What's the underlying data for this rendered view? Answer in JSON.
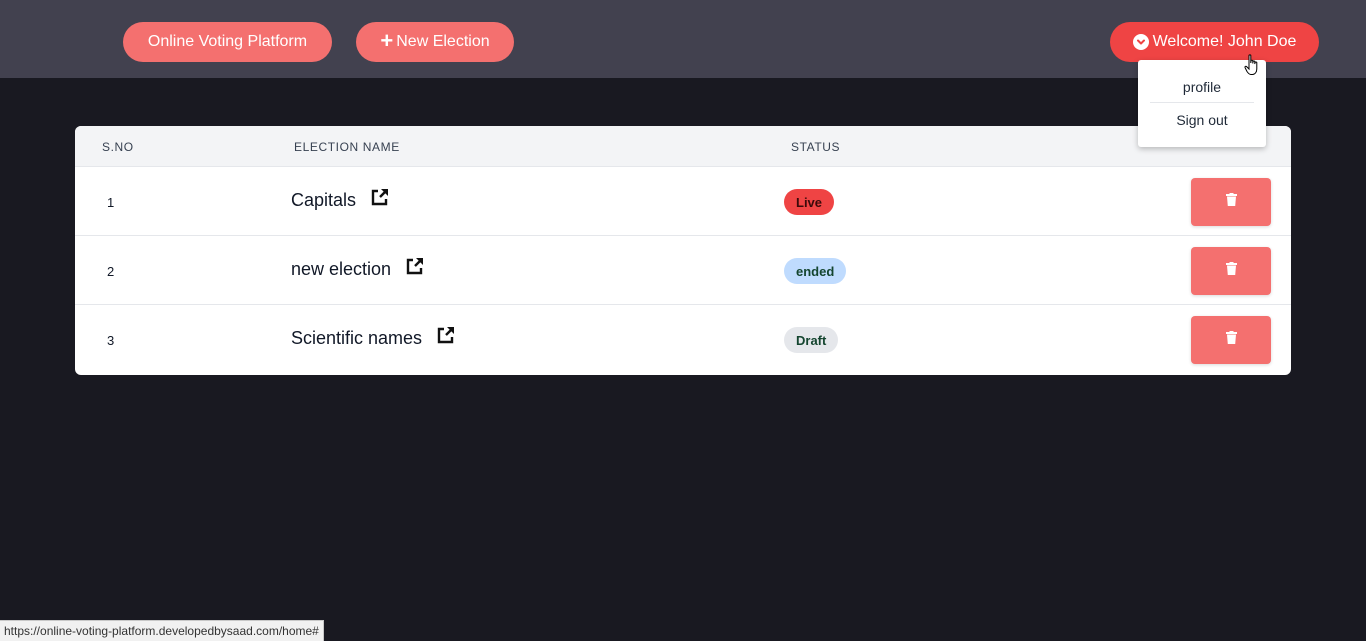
{
  "header": {
    "brand_label": "Online Voting Platform",
    "new_election_label": "New Election",
    "welcome_label": "Welcome! John Doe"
  },
  "user_menu": {
    "profile_label": "profile",
    "signout_label": "Sign out"
  },
  "table": {
    "columns": {
      "sno": "S.NO",
      "name": "ELECTION NAME",
      "status": "STATUS"
    },
    "rows": [
      {
        "sno": "1",
        "name": "Capitals",
        "status": "Live"
      },
      {
        "sno": "2",
        "name": "new election",
        "status": "ended"
      },
      {
        "sno": "3",
        "name": "Scientific names",
        "status": "Draft"
      }
    ]
  },
  "status_colors": {
    "Live": {
      "bg": "#ef4444",
      "fg": "#3b0a0a"
    },
    "ended": {
      "bg": "#bfdbfe",
      "fg": "#14452f"
    },
    "Draft": {
      "bg": "#e5e7eb",
      "fg": "#14452f"
    }
  },
  "colors": {
    "accent": "#f4706f",
    "welcome": "#ef4444"
  },
  "status_bar": {
    "url": "https://online-voting-platform.developedbysaad.com/home#"
  }
}
